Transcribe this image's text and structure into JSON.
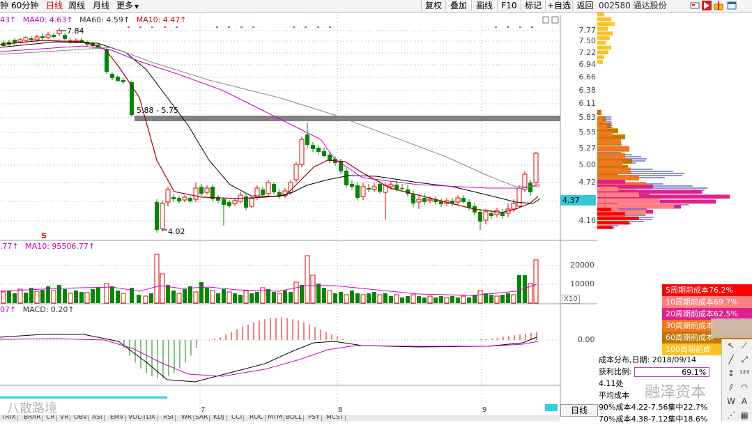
{
  "toolbar": {
    "periods": [
      {
        "label": "钟",
        "active": false
      },
      {
        "label": "60分钟",
        "active": false
      },
      {
        "label": "日线",
        "active": true
      },
      {
        "label": "周线",
        "active": false
      },
      {
        "label": "月线",
        "active": false
      },
      {
        "label": "更多",
        "active": false
      }
    ],
    "more_arrow": "▼",
    "buttons": [
      "复权",
      "叠加",
      "画线",
      "F10",
      "标记",
      "+自选",
      "返回"
    ]
  },
  "stock": {
    "code_name": "002580 通达股份"
  },
  "indicators": {
    "ma_line": [
      {
        "text": "43↑",
        "color": "#c000c0"
      },
      {
        "text": "MA40: 4.63↑",
        "color": "#c000c0"
      },
      {
        "text": "MA60: 4.59↑",
        "color": "#333333"
      },
      {
        "text": "MA10: 4.47↑",
        "color": "#cc0000"
      }
    ],
    "vol_line": [
      {
        "text": ".77↑",
        "color": "#c000c0"
      },
      {
        "text": "MA10: 95506.77↑",
        "color": "#c000c0"
      }
    ],
    "macd_line": [
      {
        "text": "07↑",
        "color": "#c000c0"
      },
      {
        "text": "MACD: 0.20↑",
        "color": "#333333"
      }
    ]
  },
  "price_axis": [
    "7.77",
    "7.50",
    "7.22",
    "6.94",
    "6.66",
    "6.38",
    "6.11",
    "5.83",
    "5.55",
    "5.27",
    "5.00",
    "4.72",
    "4.16"
  ],
  "current_price": "4.37",
  "volume_axis": [
    "20000",
    "10000"
  ],
  "volume_scale": "X10",
  "macd_axis": "0.00",
  "chart_annotations": {
    "high": "7.84",
    "low": "4.02",
    "range": "5.88 - 5.75",
    "marker": "S"
  },
  "x_months": [
    "7",
    "8",
    "9"
  ],
  "day_button": "日线",
  "bottom_tabs": [
    "TRIX",
    "BRAR",
    "CR",
    "VR",
    "OBV",
    "ASI",
    "EMV",
    "VOL-TDX",
    "RSI",
    "WR",
    "SAR",
    "KDJ",
    "CCI",
    "ROC",
    "MTM",
    "BOLL",
    "PSY",
    "MCST"
  ],
  "cost_legend": [
    {
      "text": "5周期前成本76.2%",
      "bg": "#ff0000",
      "color": "#ffffff"
    },
    {
      "text": "10周期前成本69.7%",
      "bg": "#ff8080",
      "color": "#ffffff"
    },
    {
      "text": "20周期前成本62.5%",
      "bg": "#e0208c",
      "color": "#ffffff"
    },
    {
      "text": "30周期前成本",
      "bg": "#f07820",
      "color": "#ffffff"
    },
    {
      "text": "60周期前成本",
      "bg": "#c07800",
      "color": "#ffffff"
    },
    {
      "text": "100周期前成",
      "bg": "#ffc020",
      "color": "#ffffff"
    }
  ],
  "cost_stats": {
    "dist_label": "成本分布,日期:",
    "dist_date": "2018/09/14",
    "profit_label": "获利比例:",
    "profit_value": "69.1%",
    "line3": "4.11处",
    "line4": "平均成本",
    "line5": "90%成本4.22-7.56集中22.7%",
    "line6": "70%成本4.38-7.12集中18.6%"
  },
  "watermarks": {
    "left": "八散路境",
    "right": "融泽资本"
  },
  "colors": {
    "up": "#e00000",
    "down": "#008800",
    "ma5": "#000000",
    "ma10": "#990000",
    "ma40": "#cc00cc",
    "ma60": "#888888",
    "band": "#808080",
    "price_tag": "#35c8d8"
  }
}
